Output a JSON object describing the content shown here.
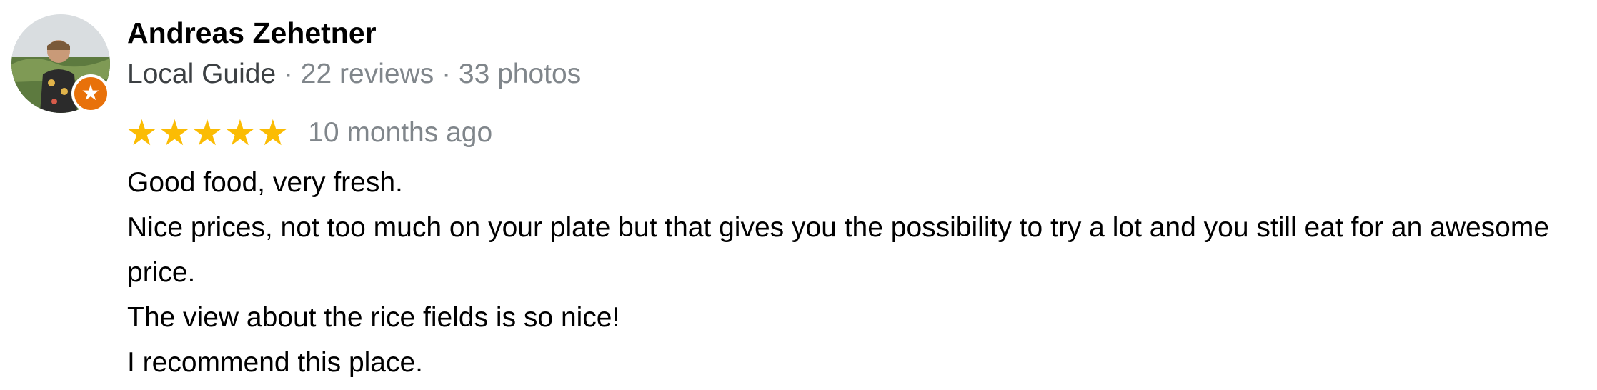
{
  "reviewer": {
    "name": "Andreas Zehetner",
    "guide_label": "Local Guide",
    "reviews": "· 22 reviews",
    "photos": "· 33 photos"
  },
  "rating": {
    "stars": 5,
    "max_stars": 5,
    "star_glyph": "★",
    "time": "10 months ago"
  },
  "review": {
    "lines": [
      "Good food, very fresh.",
      "Nice prices, not too much on your plate but that gives you the possibility to try a lot and you still eat for an awesome price.",
      "The view about the rice fields is so nice!",
      "I recommend this place."
    ]
  },
  "icons": {
    "avatar": "reviewer-avatar",
    "badge": "local-guide-star-icon"
  },
  "colors": {
    "star": "#fbbc04",
    "badge": "#e8710a",
    "muted_text": "#80868b"
  }
}
